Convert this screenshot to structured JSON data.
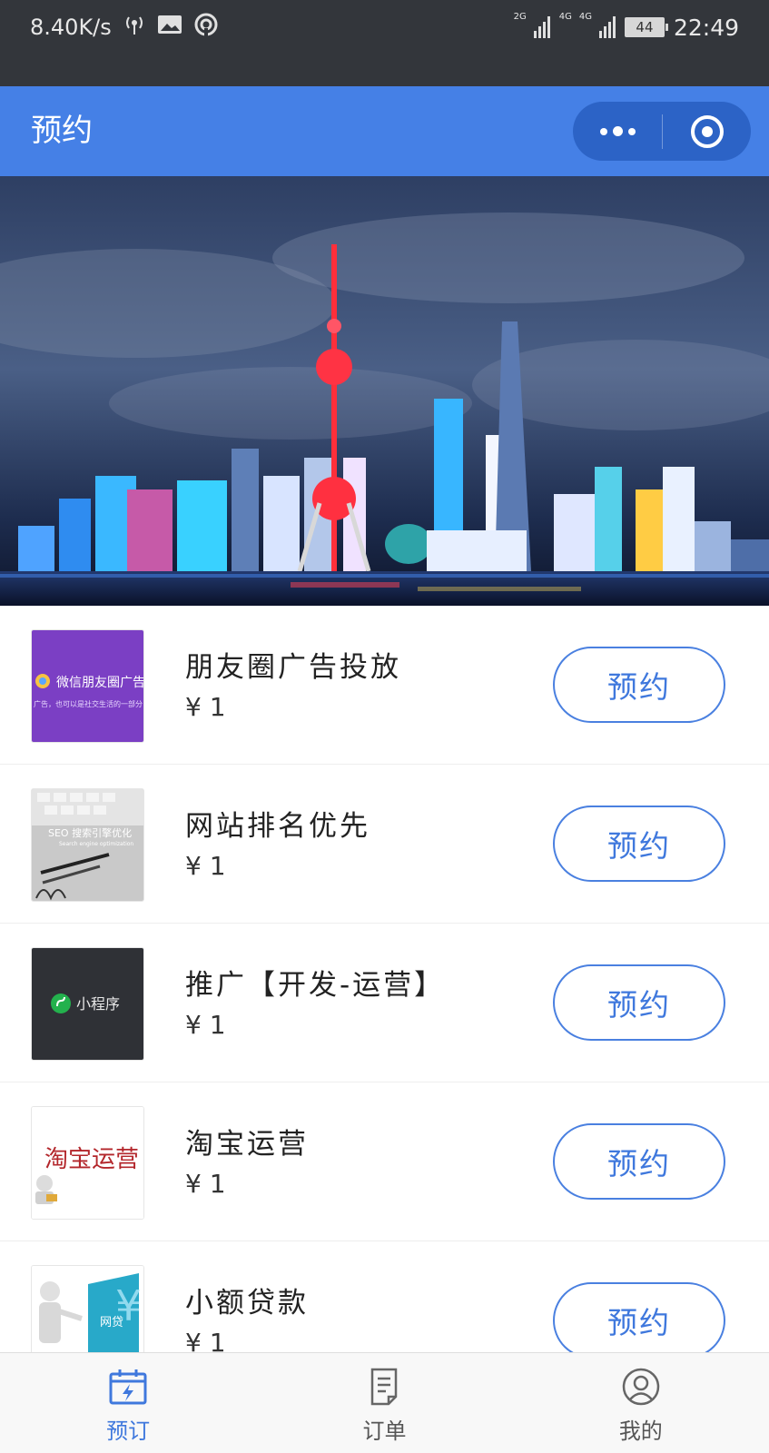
{
  "status_bar": {
    "speed": "8.40K/s",
    "net1": "2G",
    "net2": "4G",
    "net3": "4G",
    "battery": "44",
    "time": "22:49"
  },
  "header": {
    "title": "预约"
  },
  "products": [
    {
      "name": "朋友圈广告投放",
      "price": "¥ 1",
      "button": "预约",
      "thumb_caption": "微信朋友圈广告",
      "thumb_sub": "广告，也可以是社交生活的一部分"
    },
    {
      "name": "网站排名优先",
      "price": "¥ 1",
      "button": "预约",
      "thumb_caption": "SEO 搜索引擎优化",
      "thumb_sub": "Search engine optimization"
    },
    {
      "name": "推广【开发-运营】",
      "price": "¥ 1",
      "button": "预约",
      "thumb_caption": "小程序",
      "thumb_sub": ""
    },
    {
      "name": "淘宝运营",
      "price": "¥ 1",
      "button": "预约",
      "thumb_caption": "淘宝运营",
      "thumb_sub": ""
    },
    {
      "name": "小额贷款",
      "price": "¥ 1",
      "button": "预约",
      "thumb_caption": "网贷",
      "thumb_sub": ""
    }
  ],
  "tabs": [
    {
      "label": "预订",
      "icon": "calendar-bolt-icon",
      "active": true
    },
    {
      "label": "订单",
      "icon": "document-icon",
      "active": false
    },
    {
      "label": "我的",
      "icon": "user-icon",
      "active": false
    }
  ],
  "colors": {
    "primary": "#4580e6",
    "status_bar": "#33363b",
    "button_border": "#4a80e0"
  }
}
